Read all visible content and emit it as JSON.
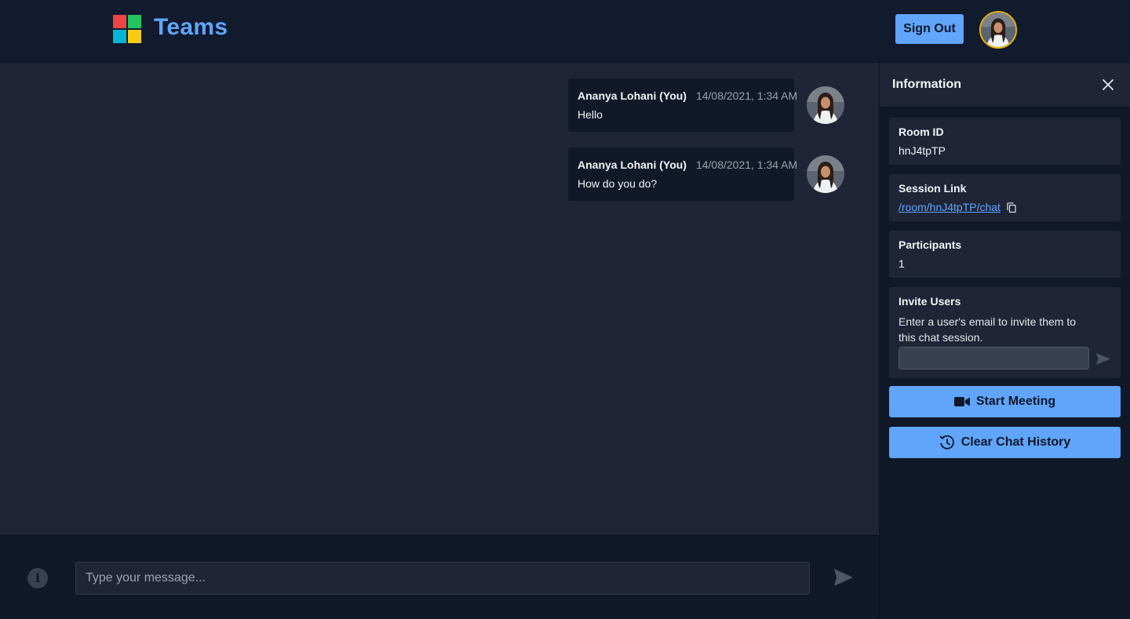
{
  "header": {
    "brand": "Teams",
    "sign_out_label": "Sign Out",
    "logo_colors": [
      "#ef4444",
      "#22c55e",
      "#06b6d4",
      "#facc15"
    ]
  },
  "messages": [
    {
      "author": "Ananya Lohani (You)",
      "time": "14/08/2021, 1:34 AM",
      "text": "Hello"
    },
    {
      "author": "Ananya Lohani (You)",
      "time": "14/08/2021, 1:34 AM",
      "text": "How do you do?"
    }
  ],
  "composer": {
    "placeholder": "Type your message...",
    "info_icon": "info-icon",
    "send_icon": "send-icon"
  },
  "sidebar": {
    "title": "Information",
    "room": {
      "label": "Room ID",
      "value": "hnJ4tpTP"
    },
    "session": {
      "label": "Session Link",
      "value": "/room/hnJ4tpTP/chat"
    },
    "participants": {
      "label": "Participants",
      "value": "1"
    },
    "invite": {
      "label": "Invite Users",
      "description": "Enter a user's email to invite them to this chat session.",
      "value": ""
    },
    "start_meeting_label": "Start Meeting",
    "clear_history_label": "Clear Chat History"
  },
  "colors": {
    "accent": "#60a5fa",
    "background": "#111827",
    "panel": "#1f2537",
    "avatar_ring": "#eab308"
  }
}
